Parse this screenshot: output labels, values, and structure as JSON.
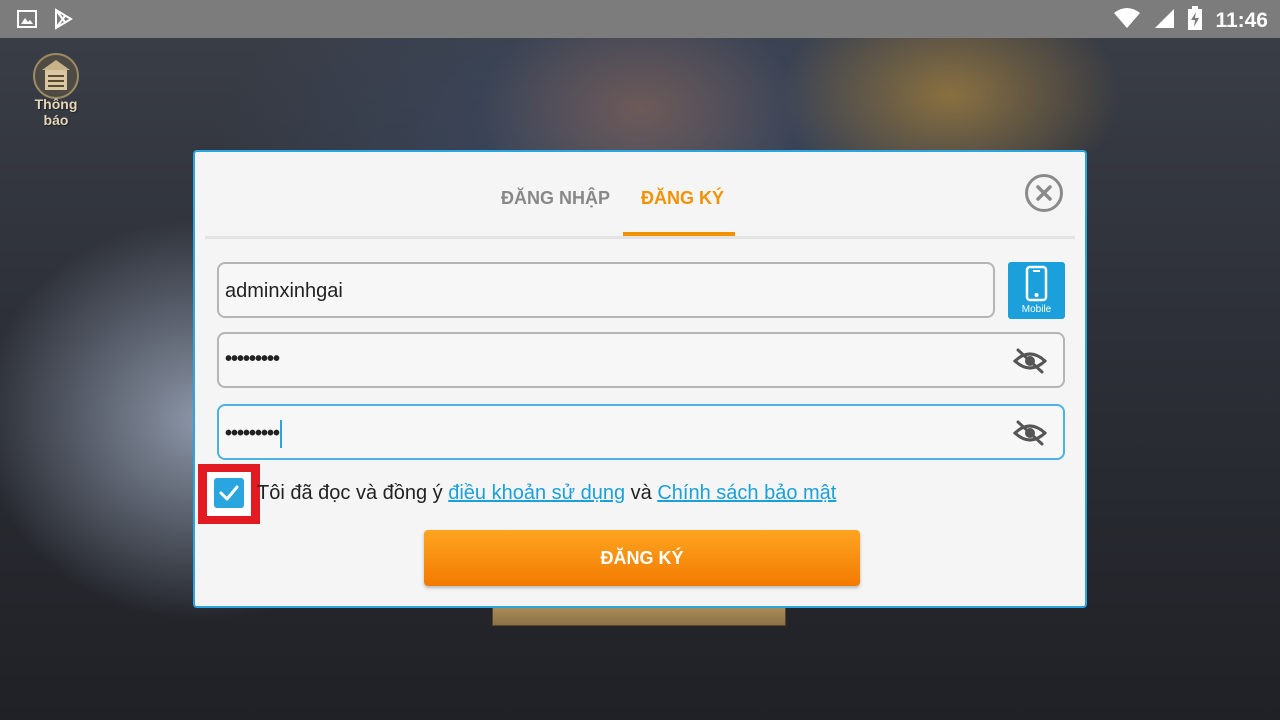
{
  "status_bar": {
    "time": "11:46",
    "left_icons": [
      "image-icon",
      "play-store-icon"
    ],
    "right_icons": [
      "wifi-icon",
      "cellular-signal-icon",
      "battery-charging-icon"
    ]
  },
  "notice": {
    "label": "Thông báo",
    "icon": "notice-board-icon"
  },
  "dialog": {
    "tabs": [
      {
        "label": "ĐĂNG NHẬP",
        "active": false
      },
      {
        "label": "ĐĂNG KÝ",
        "active": true
      }
    ],
    "close_icon": "close-icon",
    "username": {
      "value": "adminxinhgai"
    },
    "mobile_button": {
      "label": "Mobile",
      "icon": "mobile-phone-icon"
    },
    "password": {
      "value": "•••••••••",
      "icon": "eye-slash-icon"
    },
    "confirm_password": {
      "value": "•••••••••",
      "icon": "eye-slash-icon"
    },
    "agreement": {
      "checked": true,
      "text_before": "Tôi đã đọc và đồng ý ",
      "terms_link": "điều khoản sử dụng",
      "text_between": " và ",
      "privacy_link": "Chính sách bảo mật"
    },
    "submit_label": "ĐĂNG KÝ"
  },
  "colors": {
    "accent_orange": "#f39200",
    "accent_blue": "#29a6e0",
    "highlight_red": "#e21b22"
  }
}
